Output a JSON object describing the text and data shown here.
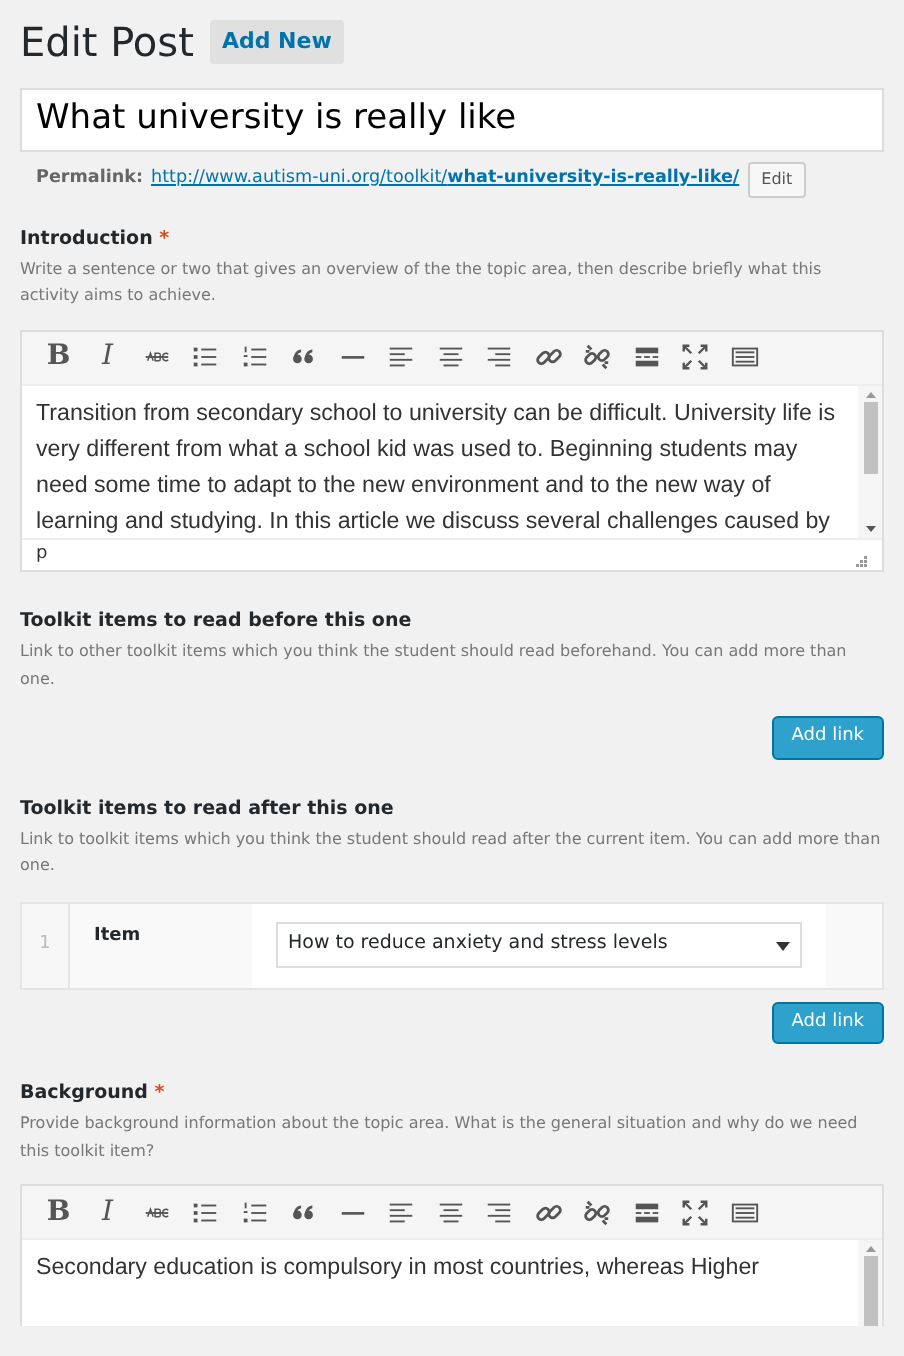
{
  "heading": {
    "title": "Edit Post",
    "add_new": "Add New"
  },
  "post_title": {
    "value": "What university is really like"
  },
  "permalink": {
    "label": "Permalink:",
    "url_base": "http://www.autism-uni.org/toolkit/",
    "slug": "what-university-is-really-like/",
    "edit": "Edit"
  },
  "sections": [
    {
      "kind": "editor",
      "label": "Introduction",
      "required_mark": "*",
      "help": "Write a sentence or two that gives an overview of the the topic area, then describe briefly what this activity aims to achieve.",
      "toolbar": [
        {
          "kind": "bold",
          "label": "B"
        },
        {
          "kind": "italic",
          "label": "I"
        },
        {
          "kind": "strike"
        },
        {
          "kind": "bullets"
        },
        {
          "kind": "numbers"
        },
        {
          "kind": "quote"
        },
        {
          "kind": "rule"
        },
        {
          "kind": "align-left"
        },
        {
          "kind": "align-center"
        },
        {
          "kind": "align-right"
        },
        {
          "kind": "link"
        },
        {
          "kind": "unlink"
        },
        {
          "kind": "more"
        },
        {
          "kind": "fullscreen"
        },
        {
          "kind": "keyboard"
        }
      ],
      "content": "Transition from secondary school to university can be difficult. University life is very different from what a school kid was used to. Beginning students may need some time to adapt to the new environment and to the new way of learning and studying. In this article we discuss several challenges caused by",
      "path": "p"
    },
    {
      "kind": "links",
      "label": "Toolkit items to read before this one",
      "help": "Link to other toolkit items which you think the student should read beforehand. You can add more than one.",
      "button": "Add link"
    },
    {
      "kind": "links",
      "label": "Toolkit items to read after this one",
      "help": "Link to toolkit items which you think the student should read after the current item. You can add more than one.",
      "rows": [
        {
          "number": "1",
          "label": "Item",
          "value": "How to reduce anxiety and stress levels"
        }
      ],
      "button": "Add link"
    },
    {
      "kind": "editor",
      "label": "Background",
      "required_mark": "*",
      "help": "Provide background information about the topic area. What is the general situation and why do we need this toolkit item?",
      "toolbar": [
        {
          "kind": "bold",
          "label": "B"
        },
        {
          "kind": "italic",
          "label": "I"
        },
        {
          "kind": "strike"
        },
        {
          "kind": "bullets"
        },
        {
          "kind": "numbers"
        },
        {
          "kind": "quote"
        },
        {
          "kind": "rule"
        },
        {
          "kind": "align-left"
        },
        {
          "kind": "align-center"
        },
        {
          "kind": "align-right"
        },
        {
          "kind": "link"
        },
        {
          "kind": "unlink"
        },
        {
          "kind": "more"
        },
        {
          "kind": "fullscreen"
        },
        {
          "kind": "keyboard"
        }
      ],
      "content": "Secondary education is compulsory in most countries, whereas Higher"
    }
  ]
}
